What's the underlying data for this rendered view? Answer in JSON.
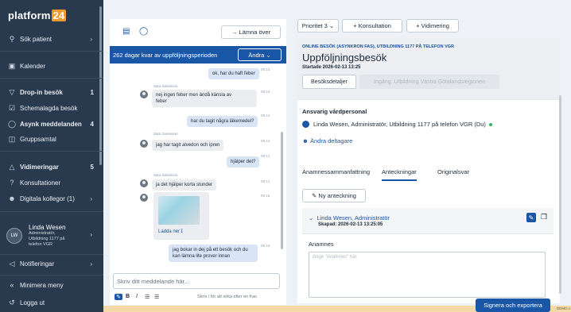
{
  "sidebar": {
    "brand": "platform",
    "brand_num": "24",
    "search": "Sök patient",
    "calendar": "Kalender",
    "dropin": "Drop-in besök",
    "dropin_count": "1",
    "scheduled": "Schemalagda besök",
    "async": "Asynk meddelanden",
    "async_count": "4",
    "group": "Gruppsamtal",
    "video": "Vidimeringar",
    "video_count": "5",
    "consult": "Konsultationer",
    "colleagues": "Digitala kollegor (1)",
    "user_initials": "LW",
    "user_name": "Linda Wesen",
    "user_role1": "Administratör,",
    "user_role2": "Utbildning 1177 på",
    "user_role3": "telefon VGR",
    "notifications": "Notifieringar",
    "minimize": "Minimera meny",
    "logout": "Logga ut"
  },
  "chat": {
    "leave": "Lämna över",
    "banner": "262 dagar kvar av uppföljningsperioden",
    "change": "Ändra",
    "sender": "Sara Svensson",
    "messages": [
      {
        "text": "ok, har du haft feber",
        "time": "09:13"
      },
      {
        "text1": "nej ingen feber men ändå känsla av",
        "text2": "feber",
        "time": "09:13"
      },
      {
        "text": "har du tagit några läkemedel?",
        "time": "09:14"
      },
      {
        "text": "jag har tagit alvedon och ipren",
        "time": "09:14"
      },
      {
        "text": "hjälper det?",
        "time": "09:14"
      },
      {
        "text": "ja det hjälper korta stunder",
        "time": "09:14"
      },
      {
        "time": "09:15"
      },
      {
        "text1": "jag bokar in dej på ett besök och du",
        "text2": "kan lämna lite prover innan",
        "time": "09:16"
      }
    ],
    "download": "Ladda ner",
    "composer_placeholder": "Skriv ditt meddelande här...",
    "hint": "Skriv  /  för att söka efter en fras"
  },
  "right": {
    "priority": "Prioritet 3",
    "consult": "+ Konsultation",
    "vidim": "+ Vidimering",
    "kicker": "ONLINE BESÖK (ASYNKRON FAS), UTBILDNING 1177 PÅ TELEFON VGR",
    "title": "Uppföljningsbesök",
    "started": "Startade 2026-02-13 13:25",
    "tab_details": "Besöksdetaljer",
    "tab_part": "Ingång: Utbildning Västra Götalandsregionen",
    "staff_title": "Ansvarig vårdpersonal",
    "staff_line": "Linda Wesen, Administratör, Utbildning 1177 på telefon VGR  (Du)",
    "change_part": "Ändra deltagare",
    "tab_anamnes": "Anamnessammanfattning",
    "tab_notes": "Anteckningar",
    "tab_original": "Originalsvar",
    "new_note": "Ny anteckning",
    "note_author": "Linda Wesen, Administratör",
    "note_created": "Skapad: 2026-02-13 13:25:05",
    "field_label": "Anamnes",
    "field_placeholder": "Ange \"Anamnes\" här",
    "sign": "Signera och exportera",
    "demo": "DEMO v"
  }
}
